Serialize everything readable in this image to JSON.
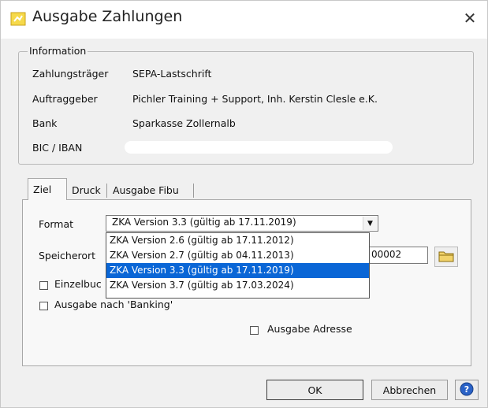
{
  "window": {
    "title": "Ausgabe Zahlungen",
    "close_glyph": "✕",
    "app_icon": "app-icon",
    "accent_color": "#0a66d6"
  },
  "information": {
    "legend": "Information",
    "rows": [
      {
        "label": "Zahlungsträger",
        "value": "SEPA-Lastschrift"
      },
      {
        "label": "Auftraggeber",
        "value": "Pichler Training + Support, Inh. Kerstin Clesle e.K."
      },
      {
        "label": "Bank",
        "value": "Sparkasse Zollernalb"
      },
      {
        "label": "BIC / IBAN",
        "value": ""
      }
    ]
  },
  "tabs": [
    {
      "label": "Ziel",
      "active": true
    },
    {
      "label": "Druck",
      "active": false
    },
    {
      "label": "Ausgabe Fibu",
      "active": false
    }
  ],
  "ziel": {
    "format_label": "Format",
    "format_selected": "ZKA Version 3.3 (gültig ab 17.11.2019)",
    "format_options": [
      "ZKA Version 2.6 (gültig ab 17.11.2012)",
      "ZKA Version 2.7 (gültig ab 04.11.2013)",
      "ZKA Version 3.3 (gültig ab 17.11.2019)",
      "ZKA Version 3.7 (gültig ab 17.03.2024)"
    ],
    "format_highlighted_index": 2,
    "speicherort_label": "Speicherort",
    "speicherort_value": "00002",
    "einzelbuchung_label": "Einzelbuc",
    "banking_label": "Ausgabe nach 'Banking'",
    "adresse_label": "Ausgabe Adresse",
    "folder_icon": "folder-icon"
  },
  "buttons": {
    "ok": "OK",
    "cancel": "Abbrechen",
    "help_icon": "help-icon"
  }
}
